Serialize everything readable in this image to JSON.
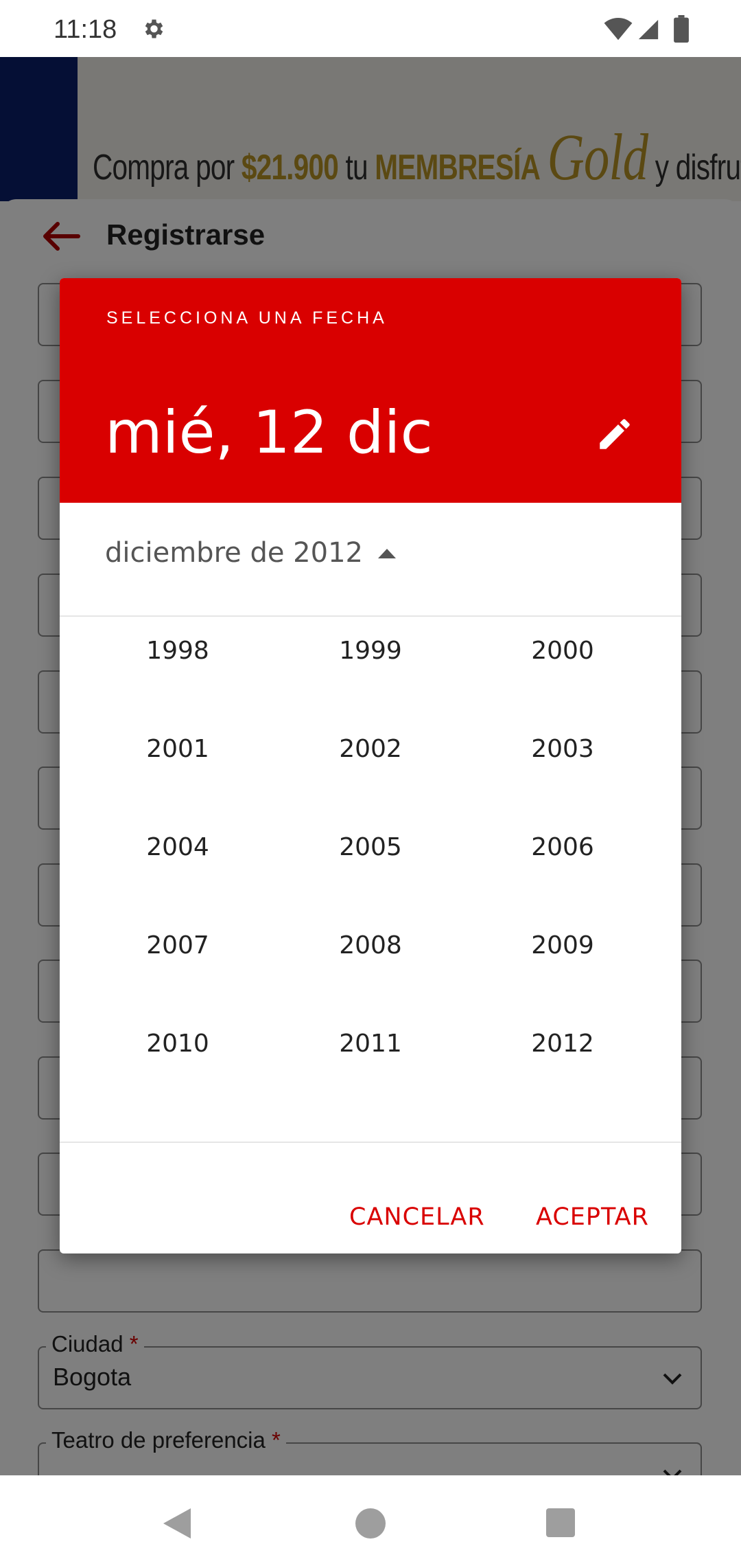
{
  "status_bar": {
    "time": "11:18",
    "icons": [
      "gear-icon",
      "wifi-icon",
      "signal-icon",
      "battery-icon"
    ]
  },
  "banner": {
    "prefix": "Compra por ",
    "price": "$21.900",
    "middle": " tu ",
    "membership": "MEMBRESÍA",
    "gold": "Gold",
    "suffix": " y disfruta un año de be"
  },
  "form": {
    "title": "Registrarse",
    "fields": [
      {
        "label": "Ciudad",
        "required": true,
        "value": "Bogota"
      },
      {
        "label": "Teatro de preferencia",
        "required": true,
        "value": ""
      }
    ]
  },
  "dialog": {
    "subtitle": "SELECCIONA UNA FECHA",
    "selected_date": "mié, 12 dic",
    "month_label": "diciembre de 2012",
    "years": [
      "1998",
      "1999",
      "2000",
      "2001",
      "2002",
      "2003",
      "2004",
      "2005",
      "2006",
      "2007",
      "2008",
      "2009",
      "2010",
      "2011",
      "2012"
    ],
    "cancel_label": "CANCELAR",
    "accept_label": "ACEPTAR"
  },
  "colors": {
    "accent": "#d90000",
    "scrim": "rgba(0,0,0,0.5)"
  }
}
